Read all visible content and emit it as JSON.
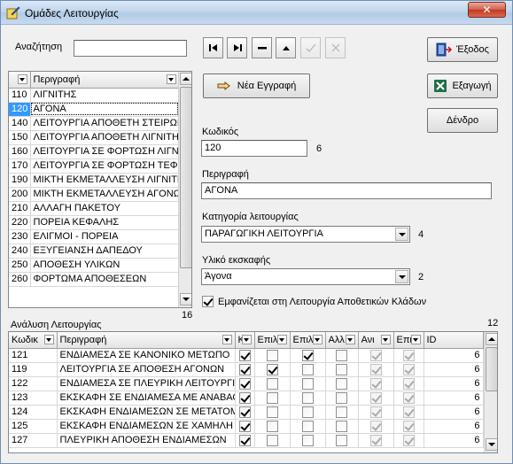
{
  "window": {
    "title": "Ομάδες Λειτουργίας",
    "close_label": "✕"
  },
  "search": {
    "label": "Αναζήτηση",
    "value": ""
  },
  "buttons": {
    "exit": "Έξοδος",
    "new_record": "Νέα Εγγραφή",
    "export": "Εξαγωγή",
    "tree": "Δένδρο"
  },
  "nav": [
    "first",
    "last",
    "delete",
    "up",
    "confirm",
    "cancel"
  ],
  "group_list": {
    "headers": [
      "",
      "Περιγραφή"
    ],
    "rows": [
      {
        "code": "110",
        "desc": "ΛΙΓΝΙΤΗΣ"
      },
      {
        "code": "120",
        "desc": "ΑΓΟΝΑ"
      },
      {
        "code": "140",
        "desc": "ΛΕΙΤΟΥΡΓΙΑ ΑΠΟΘΕΤΗ ΣΤΕΙΡΩΝ"
      },
      {
        "code": "150",
        "desc": "ΛΕΙΤΟΥΡΓΙΑ ΑΠΟΘΕΤΗ ΛΙΓΝΙΤΗ"
      },
      {
        "code": "160",
        "desc": "ΛΕΙΤΟΥΡΓΙΑ ΣΕ ΦΟΡΤΩΣΗ ΛΙΓΝ"
      },
      {
        "code": "170",
        "desc": "ΛΕΙΤΟΥΡΓΙΑ ΣΕ ΦΟΡΤΩΣΗ ΤΕΦ"
      },
      {
        "code": "190",
        "desc": "ΜΙΚΤΗ ΕΚΜΕΤΑΛΛΕΥΣΗ ΛΙΓΝΙΤΗ"
      },
      {
        "code": "200",
        "desc": "ΜΙΚΤΗ ΕΚΜΕΤΑΛΛΕΥΣΗ ΑΓΟΝΩΝ"
      },
      {
        "code": "210",
        "desc": "ΑΛΛΑΓΗ ΠΑΚΕΤΟΥ"
      },
      {
        "code": "220",
        "desc": "ΠΟΡΕΙΑ ΚΕΦΑΛΗΣ"
      },
      {
        "code": "230",
        "desc": "ΕΛΙΓΜΟΙ - ΠΟΡΕΙΑ"
      },
      {
        "code": "240",
        "desc": "ΕΞΥΓΕΙΑΝΣΗ ΔΑΠΕΔΟΥ"
      },
      {
        "code": "250",
        "desc": "ΑΠΟΘΕΣΗ ΥΛΙΚΩΝ"
      },
      {
        "code": "260",
        "desc": "ΦΟΡΤΩΜΑ ΑΠΟΘΕΣΕΩΝ"
      }
    ],
    "selected_index": 1,
    "count": "16"
  },
  "form": {
    "code_label": "Κωδικός",
    "code_value": "120",
    "code_hint": "6",
    "desc_label": "Περιγραφή",
    "desc_value": "ΑΓΟΝΑ",
    "category_label": "Κατηγορία λειτουργίας",
    "category_value": "ΠΑΡΑΓΩΓΙΚΗ ΛΕΙΤΟΥΡΓΙΑ",
    "category_hint": "4",
    "material_label": "Υλικό εκσκαφής",
    "material_value": "Άγονα",
    "material_hint": "2",
    "visible_label": "Εμφανίζεται στη Λειτουργία Αποθετικών Κλάδων",
    "visible_checked": true
  },
  "analysis": {
    "label": "Ανάλυση Λειτουργίας",
    "count": "12",
    "headers": [
      "Κωδικ",
      "Περιγραφή",
      "Κα",
      "Επιλ",
      "Επιλ",
      "Αλλ",
      "Ανι",
      "Επι",
      "ID"
    ],
    "rows": [
      {
        "code": "121",
        "desc": "ΕΝΔΙΑΜΕΣΑ ΣΕ ΚΑΝΟΝΙΚΟ ΜΕΤΩΠΟ",
        "c": [
          true,
          false,
          true,
          false,
          true,
          true
        ],
        "id": "6"
      },
      {
        "code": "119",
        "desc": "ΛΕΙΤΟΥΡΓΙΑ ΣΕ ΑΠΟΘΕΣΗ ΑΓΟΝΩΝ",
        "c": [
          true,
          true,
          false,
          false,
          true,
          true
        ],
        "id": "6"
      },
      {
        "code": "122",
        "desc": "ΕΝΔΙΑΜΕΣΑ ΣΕ ΠΛΕΥΡΙΚΗ ΛΕΙΤΟΥΡΓΙΑ",
        "c": [
          true,
          false,
          false,
          false,
          true,
          true
        ],
        "id": "6"
      },
      {
        "code": "123",
        "desc": "ΕΚΣΚΑΦΗ ΣΕ ΕΝΔΙΑΜΕΣΑ ΜΕ ΑΝΑΒΑΘ",
        "c": [
          true,
          false,
          false,
          false,
          true,
          true
        ],
        "id": "6"
      },
      {
        "code": "124",
        "desc": "ΕΚΣΚΑΦΗ ΕΝΔΙΑΜΕΣΩΝ ΣΕ ΜΕΤΑΤΟΜ",
        "c": [
          true,
          false,
          false,
          false,
          true,
          true
        ],
        "id": "6"
      },
      {
        "code": "125",
        "desc": "ΕΚΣΚΑΦΗ ΕΝΔΙΑΜΕΣΩΝ ΣΕ ΧΑΜΗΛΗ Τ",
        "c": [
          true,
          false,
          false,
          false,
          true,
          true
        ],
        "id": "6"
      },
      {
        "code": "127",
        "desc": "ΠΛΕΥΡΙΚΗ ΑΠΟΘΕΣΗ ΕΝΔΙΑΜΕΣΩΝ",
        "c": [
          true,
          false,
          false,
          false,
          true,
          true
        ],
        "id": "6"
      }
    ]
  },
  "colors": {
    "selection": "#3399ff",
    "excel_green": "#1e7145"
  }
}
